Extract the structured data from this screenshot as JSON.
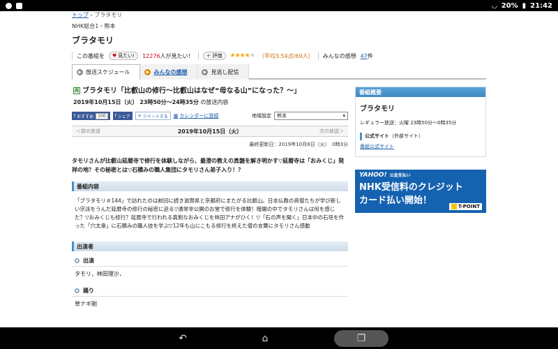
{
  "status": {
    "battery": "20%",
    "time": "21:42"
  },
  "breadcrumb": {
    "home": "トップ",
    "sep": " › ",
    "current": "ブラタモリ"
  },
  "header": {
    "channel": "NHK総合1・熊本",
    "title": "ブラタモリ",
    "want_prefix": "この番組を",
    "want_button": "見たい!",
    "want_count": "12276",
    "want_suffix": "人が見たい！",
    "rate_button": "評価",
    "rating_text": "（平均3.54点/69人）",
    "impressions_label": "みんなの感想",
    "impressions_count": "47",
    "impressions_unit": "件",
    "stars_filled": 3.5
  },
  "tabs": [
    {
      "label": "放送スケジュール",
      "active": true
    },
    {
      "label": "みんなの感想",
      "active": false
    },
    {
      "label": "見逃し配信",
      "active": false
    }
  ],
  "program": {
    "badge": "再",
    "title": "ブラタモリ「比叡山の修行〜比叡山はなぜ“母なる山”になった？〜」",
    "airtime": "2019年10月15日（火） 23時50分〜24時35分",
    "airtime_suffix": "の放送内容",
    "fb_recommend": "おすすめ",
    "fb_count": "100",
    "fb_share": "シェア",
    "tweet": "ツイートする",
    "calendar": "カレンダーに登録",
    "region_label": "地域設定",
    "region_value": "熊本",
    "prev": "＜前の放送",
    "current_date": "2019年10月15日（火）",
    "next": "次の放送＞",
    "updated": "最終更新日：2019年10月8日（火）　0時3分",
    "lead": "タモリさんが比叡山延暦寺で修行を体験しながら、最澄の教えの真髄を解き明かす▽延暦寺は「おみくじ」発祥の地？その秘密とは▽石積みの職人集団にタモリさん弟子入り！？",
    "content_heading": "番組内容",
    "content": "「ブラタモリ＃144」で訪れたのは前回に続き滋賀県と京都府にまたがる比叡山。日本仏教の高僧たちが学び新しい宗派をうんだ延暦寺の修行の秘密に迫る▽通常非公開のお堂で修行を体験！暗闇の中でタモリさんは何を感じた？▽おみくじも修行？延暦寺で行われる真剣なおみくじを林田アナがひく！▽「石の声を聞く」日本中の石垣を作った「穴太衆」に石積みの職人技を学ぶ▽12年も山にこもる修行を終えた僧の言葉にタモリさん感動",
    "cast_heading": "出演者",
    "cast_sub": "出演",
    "cast": "タモリ，林田理沙，",
    "dance_sub": "踊り",
    "dance": "草ナギ剛"
  },
  "sidebar": {
    "heading": "番組概要",
    "name": "ブラタモリ",
    "regular": "レギュラー放送：火曜 23時50分〜0時35分",
    "site_label": "公式サイト",
    "site_note": "（外部サイト）",
    "site_link": "番組公式サイト"
  },
  "ad": {
    "brand": "YAHOO!",
    "brand_sub": "公金支払い",
    "line1": "NHK受信料のクレジット",
    "line2": "カード払い開始！",
    "tpoint": "T-POINT"
  }
}
